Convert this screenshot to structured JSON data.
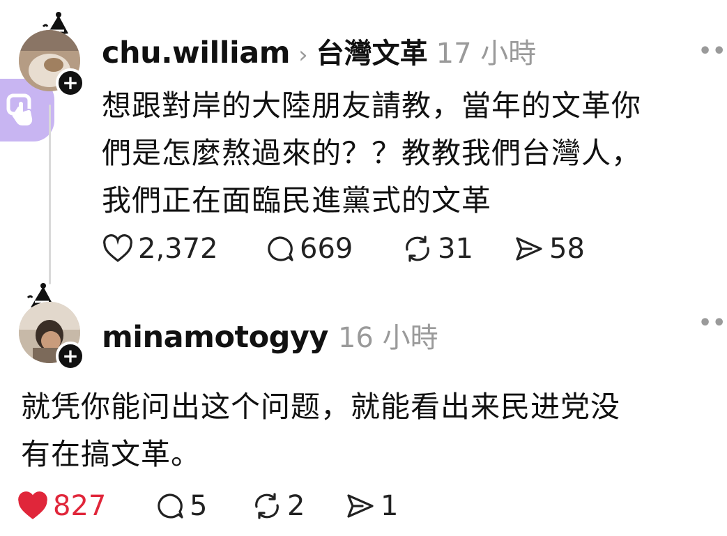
{
  "posts": [
    {
      "username": "chu.william",
      "topic": "台灣文革",
      "time": "17 小時",
      "text_lines": [
        "想跟對岸的大陸朋友請教，當年的文革你",
        "們是怎麼熬過來的？？教教我們台灣人，",
        "我們正在面臨民進黨式的文革"
      ],
      "actions": {
        "likes": "2,372",
        "comments": "669",
        "reposts": "31",
        "shares": "58"
      }
    },
    {
      "username": "minamotogyy",
      "time": "16 小時",
      "text_lines": [
        "就凭你能问出这个问题，就能看出来民进党没",
        "有在搞文革。"
      ],
      "actions": {
        "likes": "827",
        "comments": "5",
        "reposts": "2",
        "shares": "1"
      }
    }
  ],
  "icons": {
    "more": "more-horizontal-icon",
    "like": "heart-icon",
    "comment": "comment-bubble-icon",
    "repost": "repost-icon",
    "share": "send-icon",
    "follow": "plus-icon",
    "floating": "accessibility-touch-icon"
  },
  "colors": {
    "liked": "#e0263a",
    "meta": "#9a9a9a",
    "floating_button": "#c8b5f2"
  }
}
